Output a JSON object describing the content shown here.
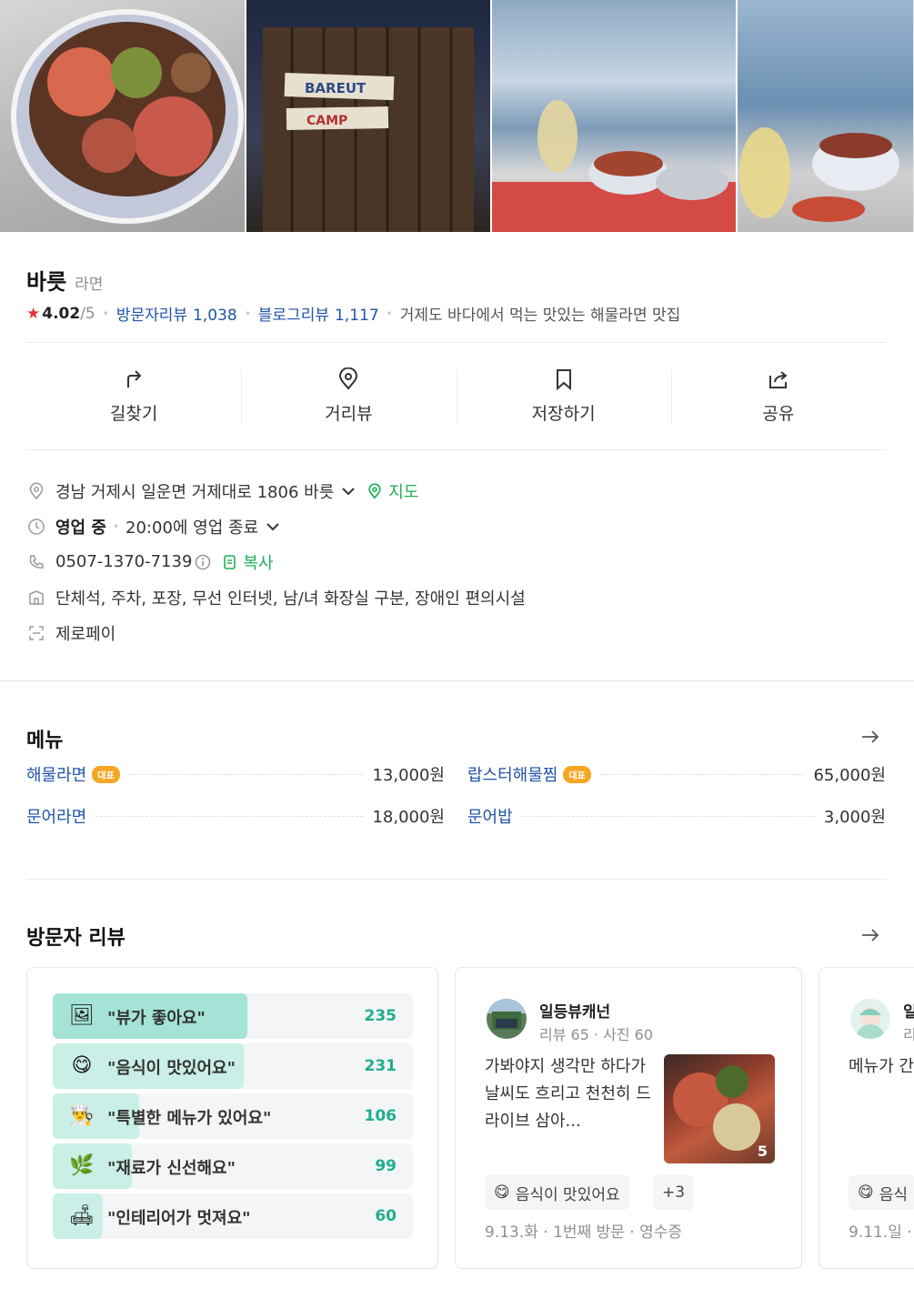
{
  "photos": [
    {
      "name": "ramen-bowl-photo"
    },
    {
      "name": "bareut-camp-sign-photo",
      "sign_line1": "BAREUT",
      "sign_line2": "CAMP"
    },
    {
      "name": "seaside-table-photo"
    },
    {
      "name": "seaside-bowl-photo"
    }
  ],
  "place": {
    "name": "바릇",
    "category": "라면",
    "rating": "4.02",
    "rating_max": "/5",
    "visitor_reviews_label": "방문자리뷰",
    "visitor_reviews_count": "1,038",
    "blog_reviews_label": "블로그리뷰",
    "blog_reviews_count": "1,117",
    "description": "거제도 바다에서 먹는 맛있는 해물라면 맛집"
  },
  "actions": [
    {
      "label": "길찾기",
      "icon": "directions-icon"
    },
    {
      "label": "거리뷰",
      "icon": "location-pin-icon"
    },
    {
      "label": "저장하기",
      "icon": "bookmark-icon"
    },
    {
      "label": "공유",
      "icon": "share-icon"
    }
  ],
  "info": {
    "address": "경남 거제시 일운면 거제대로 1806 바릇",
    "map_label": "지도",
    "status": "영업 중",
    "hours": "20:00에 영업 종료",
    "phone": "0507-1370-7139",
    "copy_label": "복사",
    "amenities": "단체석, 주차, 포장, 무선 인터넷, 남/녀 화장실 구분, 장애인 편의시설",
    "pay": "제로페이"
  },
  "menu": {
    "title": "메뉴",
    "items": [
      {
        "name": "해물라면",
        "badge": "대표",
        "price": "13,000원"
      },
      {
        "name": "랍스터해물찜",
        "badge": "대표",
        "price": "65,000원"
      },
      {
        "name": "문어라면",
        "badge": "",
        "price": "18,000원"
      },
      {
        "name": "문어밥",
        "badge": "",
        "price": "3,000원"
      }
    ]
  },
  "reviews": {
    "title": "방문자 리뷰",
    "keywords": [
      {
        "text": "\"뷰가 좋아요\"",
        "count": "235",
        "ratio": 0.54,
        "icon": "picture-icon",
        "glyph": "🖼"
      },
      {
        "text": "\"음식이 맛있어요\"",
        "count": "231",
        "ratio": 0.53,
        "icon": "smile-icon",
        "glyph": "😋"
      },
      {
        "text": "\"특별한 메뉴가 있어요\"",
        "count": "106",
        "ratio": 0.24,
        "icon": "chef-icon",
        "glyph": "👨‍🍳"
      },
      {
        "text": "\"재료가 신선해요\"",
        "count": "99",
        "ratio": 0.22,
        "icon": "leaf-icon",
        "glyph": "🌿"
      },
      {
        "text": "\"인테리어가 멋져요\"",
        "count": "60",
        "ratio": 0.14,
        "icon": "sofa-icon",
        "glyph": "🛋"
      }
    ],
    "cards": [
      {
        "author": "일등뷰캐넌",
        "meta": "리뷰 65 · 사진 60",
        "text": "가봐야지 생각만 하다가 날씨도 흐리고 천천히 드라이브 삼아...",
        "photo_count": "5",
        "chip": "음식이 맛있어요",
        "chip_more": "+3",
        "footer": "9.13.화 · 1번째 방문 · 영수증"
      },
      {
        "author": "일",
        "meta": "리",
        "text": "메뉴가 간 요. 입구부 요. 날씨가",
        "chip": "음식",
        "footer": "9.11.일 ·"
      }
    ]
  },
  "colors": {
    "accent_green": "#1fae57",
    "link_blue": "#2053a8",
    "star_red": "#e0323c",
    "badge_orange": "#f5a623",
    "keyword_fill": "#a4e3d5"
  }
}
